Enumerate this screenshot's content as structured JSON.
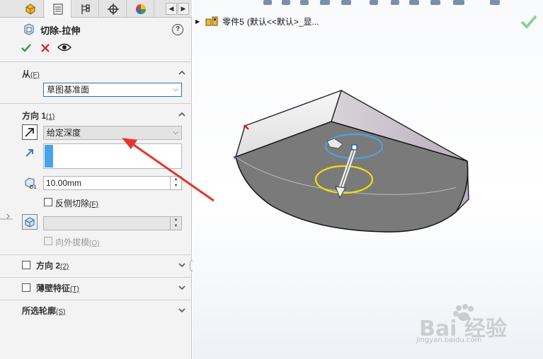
{
  "property_manager": {
    "title": "切除-拉伸",
    "help": "?",
    "from_section": {
      "title": "从",
      "shortcut": "(F)",
      "start_condition": "草图基准面"
    },
    "direction1": {
      "title": "方向 1",
      "shortcut": "(1)",
      "end_condition": "给定深度",
      "depth": "10.00mm",
      "flip_side_label": "反侧切除",
      "flip_side_shortcut": "(F)",
      "draft_outward_label": "向外拔模",
      "draft_outward_shortcut": "(O)"
    },
    "direction2": {
      "title": "方向 2",
      "shortcut": "(2)"
    },
    "thin_feature": {
      "title": "薄壁特征",
      "shortcut": "(T)"
    },
    "selected_contours": {
      "title": "所选轮廓",
      "shortcut": "(S)"
    }
  },
  "graphics": {
    "breadcrumb_part": "零件5",
    "breadcrumb_config": "(默认<<默认>_显..."
  },
  "watermark": {
    "text": "Bai 经验",
    "sub": "jingyan.baidu.com"
  },
  "colors": {
    "accent_blue": "#2f6fb5",
    "ok_green": "#2c9a3c",
    "cancel_red": "#d42020",
    "annotation_arrow": "#e8332a"
  }
}
